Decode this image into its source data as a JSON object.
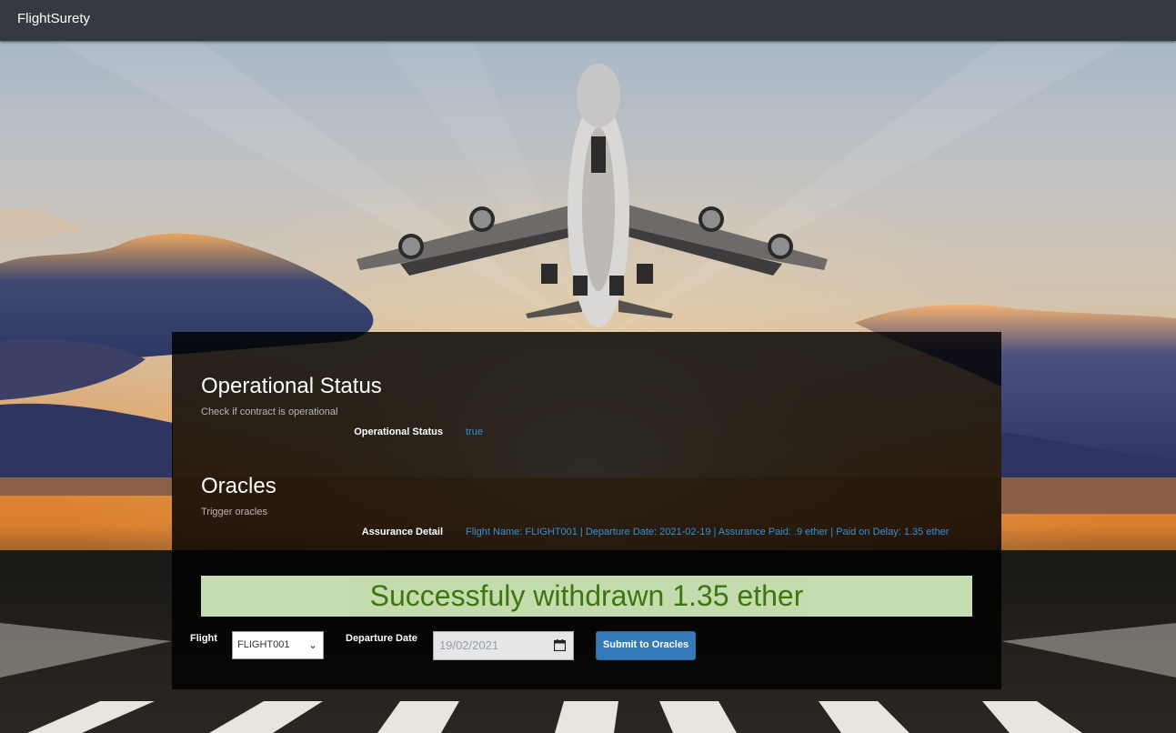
{
  "navbar": {
    "brand": "FlightSurety"
  },
  "operational": {
    "title": "Operational Status",
    "subtitle": "Check if contract is operational",
    "label": "Operational Status",
    "value": "true"
  },
  "oracles": {
    "title": "Oracles",
    "subtitle": "Trigger oracles",
    "label": "Assurance Detail",
    "value": "Flight Name: FLIGHT001 | Departure Date: 2021-02-19 | Assurance Paid: .9 ether | Paid on Delay: 1.35 ether"
  },
  "alert": {
    "message": "Successfuly withdrawn 1.35 ether"
  },
  "form": {
    "flight_label": "Flight",
    "flight_selected": "FLIGHT001",
    "date_label": "Departure Date",
    "date_value": "19/02/2021",
    "submit_label": "Submit to Oracles"
  },
  "colors": {
    "navbar": "#343a40",
    "accent_link": "#3a8fd1",
    "button": "#337ab7",
    "alert_bg": "#cfe8b7",
    "alert_text": "#3e7d12"
  }
}
